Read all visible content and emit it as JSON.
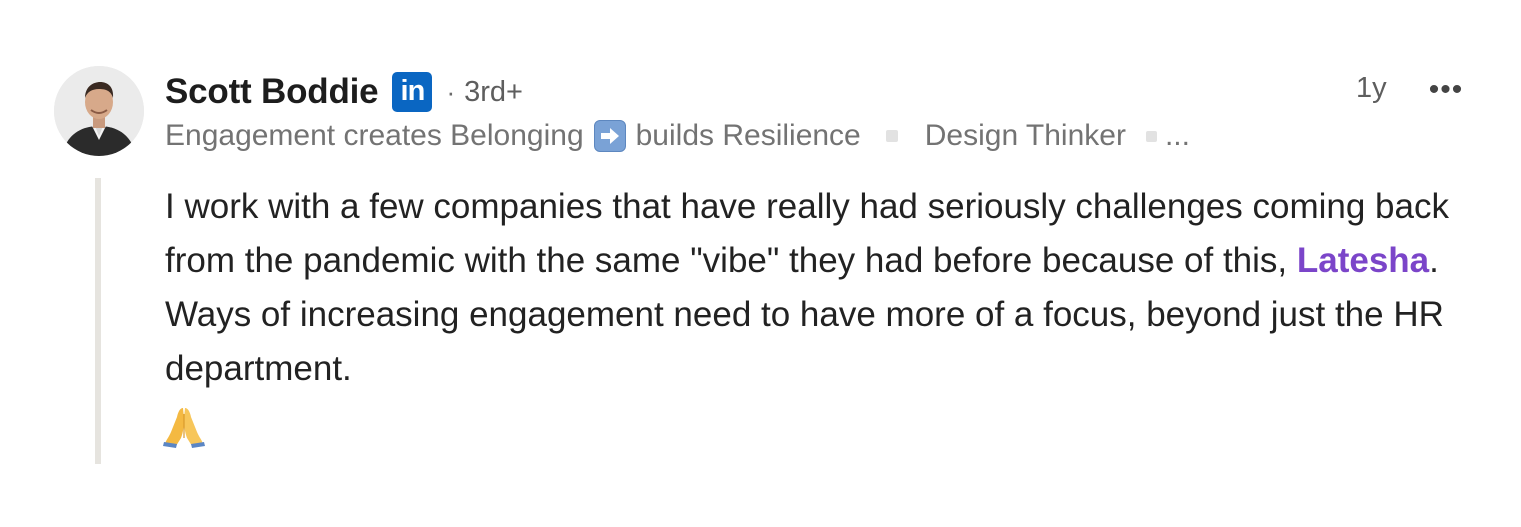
{
  "comment": {
    "author": {
      "name": "Scott Boddie",
      "badge_text": "in",
      "separator": "·",
      "connection_degree": "3rd+",
      "avatar_icon": "profile-photo"
    },
    "headline": {
      "part1": "Engagement creates Belonging",
      "arrow_icon": "right-arrow-emoji-icon",
      "part2": "builds Resilience",
      "part3": "Design Thinker",
      "overflow": "..."
    },
    "timestamp": "1y",
    "more_label": "•••",
    "body": {
      "text_before_mention": "I work with a few companies that have really had seriously challenges coming back from the pandemic with the same \"vibe\" they had before because of this, ",
      "mention": "Latesha",
      "text_after_mention": ". Ways of increasing engagement need to have more of a focus, beyond just the HR department.",
      "emoji": "folded-hands-emoji-icon"
    },
    "colors": {
      "mention": "#7b45c9",
      "linkedin_blue": "#0a66c2",
      "thread_line": "#e6e4df",
      "secondary_text": "#737373"
    }
  }
}
